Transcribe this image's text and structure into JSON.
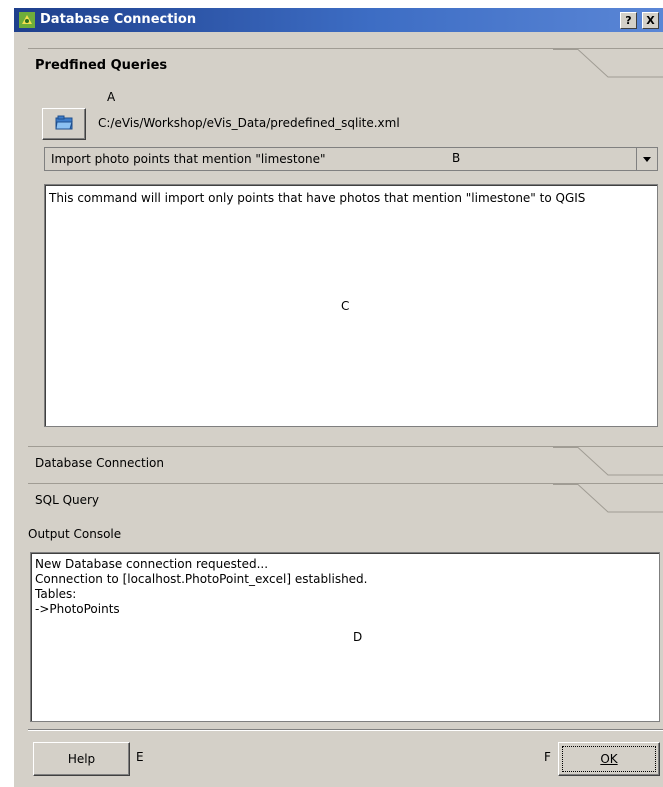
{
  "window": {
    "title": "Database Connection",
    "help_btn": "?",
    "close_btn": "X"
  },
  "predefined": {
    "header": "Predfined Queries",
    "file_path": "C:/eVis/Workshop/eVis_Data/predefined_sqlite.xml",
    "query_selected": "Import photo points that mention \"limestone\"",
    "description": "This command will import only points that have photos that mention \"limestone\" to QGIS"
  },
  "sections": {
    "database_connection": "Database Connection",
    "sql_query": "SQL Query"
  },
  "output": {
    "label": "Output Console",
    "lines": "New Database connection requested...\nConnection to [localhost.PhotoPoint_excel] established.\nTables:\n->PhotoPoints"
  },
  "buttons": {
    "help": "Help",
    "ok": "OK"
  },
  "annotations": {
    "a": "A",
    "b": "B",
    "c": "C",
    "d": "D",
    "e": "E",
    "f": "F"
  },
  "icons": {
    "title": "qgis-icon",
    "open": "folder-open-icon",
    "dropdown": "chevron-down-icon"
  }
}
